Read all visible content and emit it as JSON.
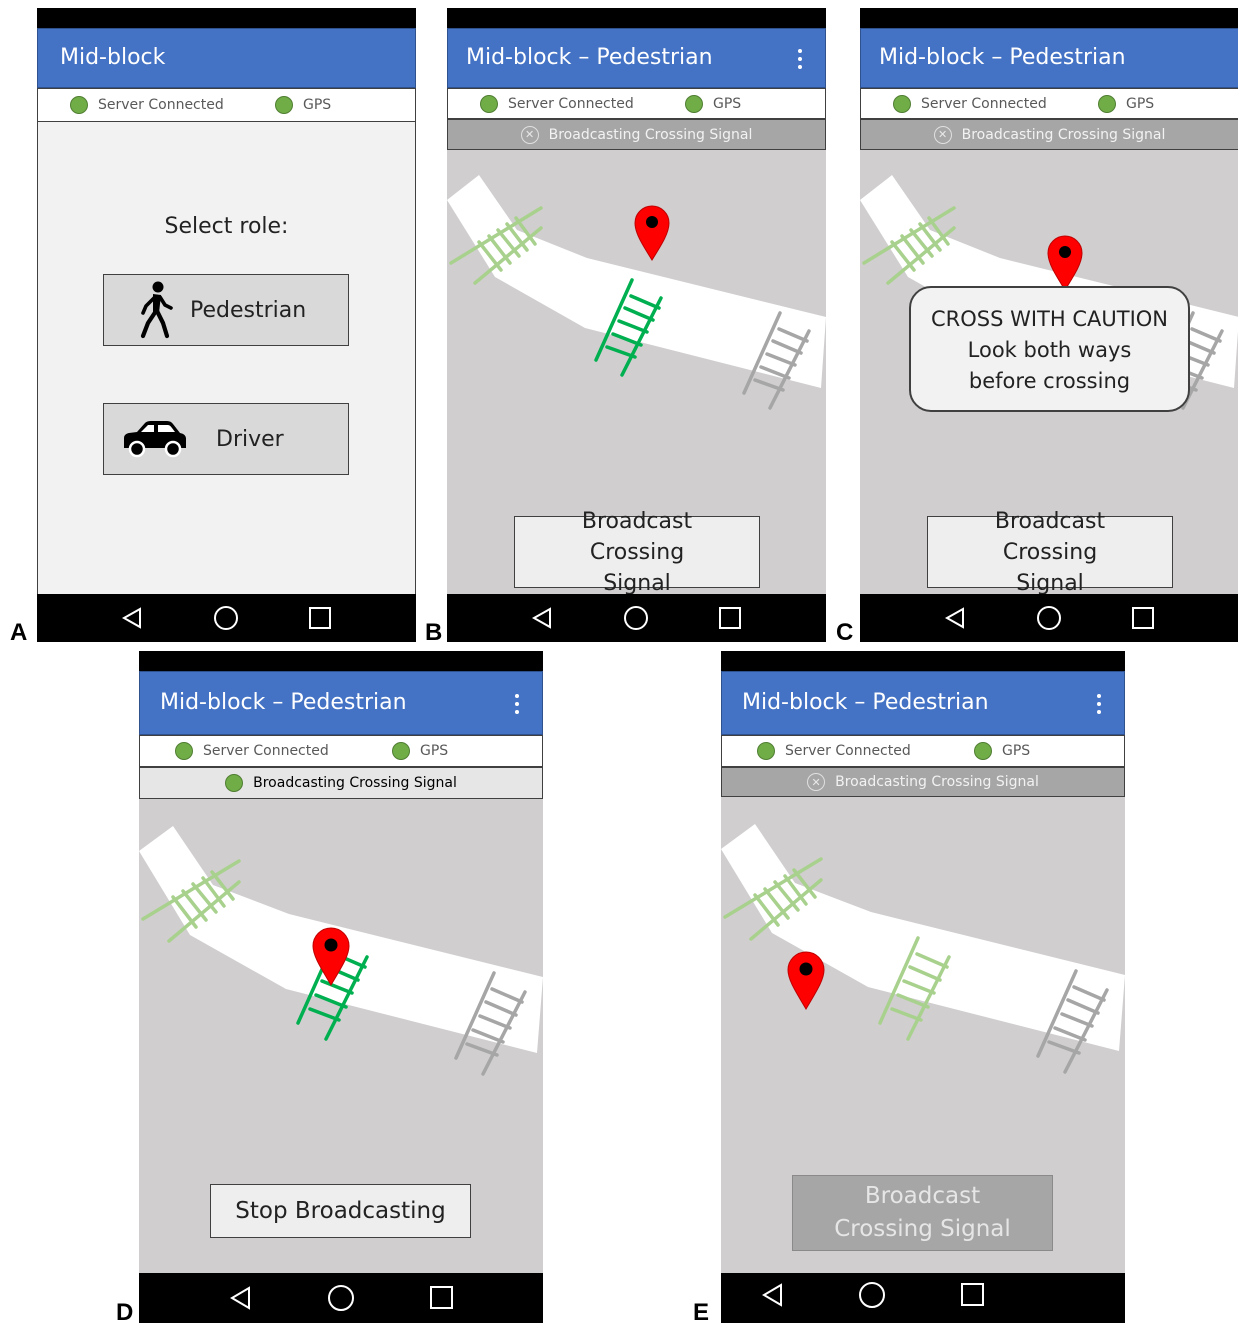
{
  "panels": {
    "A": {
      "letter": "A",
      "title": "Mid-block",
      "server_label": "Server Connected",
      "gps_label": "GPS",
      "select_role_label": "Select role:",
      "pedestrian_label": "Pedestrian",
      "driver_label": "Driver"
    },
    "B": {
      "letter": "B",
      "title": "Mid-block – Pedestrian",
      "server_label": "Server Connected",
      "gps_label": "GPS",
      "broadcast_status": "Broadcasting Crossing Signal",
      "broadcast_active": false,
      "button_label": "Broadcast Crossing Signal"
    },
    "C": {
      "letter": "C",
      "title": "Mid-block – Pedestrian",
      "server_label": "Server Connected",
      "gps_label": "GPS",
      "broadcast_status": "Broadcasting Crossing Signal",
      "broadcast_active": false,
      "caution_title": "CROSS WITH CAUTION",
      "caution_body": "Look both ways before crossing",
      "button_label": "Broadcast Crossing Signal"
    },
    "D": {
      "letter": "D",
      "title": "Mid-block – Pedestrian",
      "server_label": "Server Connected",
      "gps_label": "GPS",
      "broadcast_status": "Broadcasting Crossing Signal",
      "broadcast_active": true,
      "button_label": "Stop Broadcasting"
    },
    "E": {
      "letter": "E",
      "title": "Mid-block – Pedestrian",
      "server_label": "Server Connected",
      "gps_label": "GPS",
      "broadcast_status": "Broadcasting Crossing Signal",
      "broadcast_active": false,
      "button_label": "Broadcast Crossing Signal",
      "button_disabled": true
    }
  },
  "icons": {
    "status_ok": "green-dot-icon",
    "status_off": "x-circle-icon",
    "menu": "kebab-menu-icon",
    "location": "map-pin-icon",
    "crosswalk": "crosswalk-icon",
    "pedestrian": "walking-person-icon",
    "driver": "car-icon",
    "nav_back": "triangle-back-icon",
    "nav_home": "circle-home-icon",
    "nav_recents": "square-recents-icon"
  },
  "colors": {
    "header": "#4472c4",
    "status_ok": "#70ad47",
    "pin": "#ff0000",
    "crosswalk_active": "#00b050",
    "crosswalk_faded": "#a9d18e",
    "crosswalk_inactive": "#a6a6a6",
    "map_background": "#d0cece"
  }
}
